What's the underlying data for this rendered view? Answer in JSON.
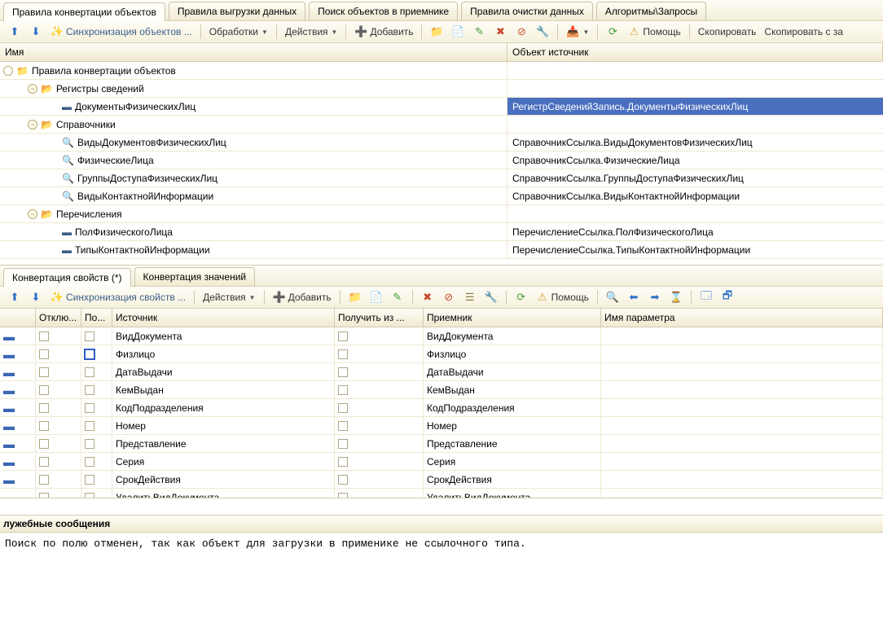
{
  "topTabs": {
    "t0": "Правила конвертации объектов",
    "t1": "Правила выгрузки данных",
    "t2": "Поиск объектов в приемнике",
    "t3": "Правила очистки данных",
    "t4": "Алгоритмы\\Запросы"
  },
  "toolbar1": {
    "sync": "Синхронизация объектов ...",
    "processing": "Обработки",
    "actions": "Действия",
    "add": "Добавить",
    "help": "Помощь",
    "copy": "Скопировать",
    "copyFrom": "Скопировать с за"
  },
  "gridHeader": {
    "name": "Имя",
    "source": "Объект источник"
  },
  "tree": {
    "r0": {
      "label": "Правила конвертации объектов"
    },
    "r1": {
      "label": "Регистры сведений"
    },
    "r2": {
      "label": "ДокументыФизическихЛиц",
      "src": "РегистрСведенийЗапись.ДокументыФизическихЛиц"
    },
    "r3": {
      "label": "Справочники"
    },
    "r4": {
      "label": "ВидыДокументовФизическихЛиц",
      "src": "СправочникСсылка.ВидыДокументовФизическихЛиц"
    },
    "r5": {
      "label": "ФизическиеЛица",
      "src": "СправочникСсылка.ФизическиеЛица"
    },
    "r6": {
      "label": "ГруппыДоступаФизическихЛиц",
      "src": "СправочникСсылка.ГруппыДоступаФизическихЛиц"
    },
    "r7": {
      "label": "ВидыКонтактнойИнформации",
      "src": "СправочникСсылка.ВидыКонтактнойИнформации"
    },
    "r8": {
      "label": "Перечисления"
    },
    "r9": {
      "label": "ПолФизическогоЛица",
      "src": "ПеречислениеСсылка.ПолФизическогоЛица"
    },
    "r10": {
      "label": "ТипыКонтактнойИнформации",
      "src": "ПеречислениеСсылка.ТипыКонтактнойИнформации"
    }
  },
  "propsTabs": {
    "t0": "Конвертация свойств (*)",
    "t1": "Конвертация значений"
  },
  "toolbar2": {
    "sync": "Синхронизация свойств ...",
    "actions": "Действия",
    "add": "Добавить",
    "help": "Помощь"
  },
  "propsHeader": {
    "off": "Отклю...",
    "po": "По...",
    "src": "Источник",
    "get": "Получить из ...",
    "dst": "Приемник",
    "param": "Имя параметра"
  },
  "props": {
    "p0": {
      "src": "ВидДокумента",
      "dst": "ВидДокумента"
    },
    "p1": {
      "src": "Физлицо",
      "dst": "Физлицо"
    },
    "p2": {
      "src": "ДатаВыдачи",
      "dst": "ДатаВыдачи"
    },
    "p3": {
      "src": "КемВыдан",
      "dst": "КемВыдан"
    },
    "p4": {
      "src": "КодПодразделения",
      "dst": "КодПодразделения"
    },
    "p5": {
      "src": "Номер",
      "dst": "Номер"
    },
    "p6": {
      "src": "Представление",
      "dst": "Представление"
    },
    "p7": {
      "src": "Серия",
      "dst": "Серия"
    },
    "p8": {
      "src": "СрокДействия",
      "dst": "СрокДействия"
    },
    "p9": {
      "src": "УдалитьВидДокумента",
      "dst": "УдалитьВидДокумента"
    }
  },
  "messages": {
    "title": "лужебные сообщения",
    "body": "Поиск по полю отменен, так как объект для загрузки в применике не ссылочного типа."
  }
}
